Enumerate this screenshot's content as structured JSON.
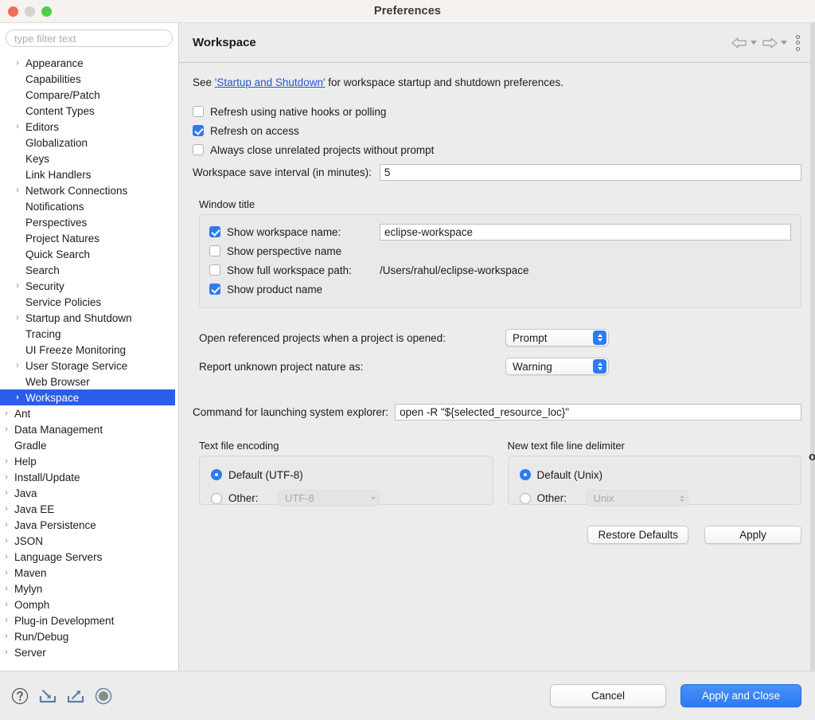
{
  "window": {
    "title": "Preferences",
    "traffic_lights": [
      "close",
      "minimize",
      "zoom"
    ]
  },
  "sidebar": {
    "filter_placeholder": "type filter text",
    "filter_value": "",
    "items": [
      {
        "label": "Appearance",
        "level": 1,
        "expandable": true,
        "selected": false
      },
      {
        "label": "Capabilities",
        "level": 1,
        "expandable": false,
        "selected": false
      },
      {
        "label": "Compare/Patch",
        "level": 1,
        "expandable": false,
        "selected": false
      },
      {
        "label": "Content Types",
        "level": 1,
        "expandable": false,
        "selected": false
      },
      {
        "label": "Editors",
        "level": 1,
        "expandable": true,
        "selected": false
      },
      {
        "label": "Globalization",
        "level": 1,
        "expandable": false,
        "selected": false
      },
      {
        "label": "Keys",
        "level": 1,
        "expandable": false,
        "selected": false
      },
      {
        "label": "Link Handlers",
        "level": 1,
        "expandable": false,
        "selected": false
      },
      {
        "label": "Network Connections",
        "level": 1,
        "expandable": true,
        "selected": false
      },
      {
        "label": "Notifications",
        "level": 1,
        "expandable": false,
        "selected": false
      },
      {
        "label": "Perspectives",
        "level": 1,
        "expandable": false,
        "selected": false
      },
      {
        "label": "Project Natures",
        "level": 1,
        "expandable": false,
        "selected": false
      },
      {
        "label": "Quick Search",
        "level": 1,
        "expandable": false,
        "selected": false
      },
      {
        "label": "Search",
        "level": 1,
        "expandable": false,
        "selected": false
      },
      {
        "label": "Security",
        "level": 1,
        "expandable": true,
        "selected": false
      },
      {
        "label": "Service Policies",
        "level": 1,
        "expandable": false,
        "selected": false
      },
      {
        "label": "Startup and Shutdown",
        "level": 1,
        "expandable": true,
        "selected": false
      },
      {
        "label": "Tracing",
        "level": 1,
        "expandable": false,
        "selected": false
      },
      {
        "label": "UI Freeze Monitoring",
        "level": 1,
        "expandable": false,
        "selected": false
      },
      {
        "label": "User Storage Service",
        "level": 1,
        "expandable": true,
        "selected": false
      },
      {
        "label": "Web Browser",
        "level": 1,
        "expandable": false,
        "selected": false
      },
      {
        "label": "Workspace",
        "level": 1,
        "expandable": true,
        "selected": true
      },
      {
        "label": "Ant",
        "level": 0,
        "expandable": true,
        "selected": false
      },
      {
        "label": "Data Management",
        "level": 0,
        "expandable": true,
        "selected": false
      },
      {
        "label": "Gradle",
        "level": 0,
        "expandable": false,
        "selected": false
      },
      {
        "label": "Help",
        "level": 0,
        "expandable": true,
        "selected": false
      },
      {
        "label": "Install/Update",
        "level": 0,
        "expandable": true,
        "selected": false
      },
      {
        "label": "Java",
        "level": 0,
        "expandable": true,
        "selected": false
      },
      {
        "label": "Java EE",
        "level": 0,
        "expandable": true,
        "selected": false
      },
      {
        "label": "Java Persistence",
        "level": 0,
        "expandable": true,
        "selected": false
      },
      {
        "label": "JSON",
        "level": 0,
        "expandable": true,
        "selected": false
      },
      {
        "label": "Language Servers",
        "level": 0,
        "expandable": true,
        "selected": false
      },
      {
        "label": "Maven",
        "level": 0,
        "expandable": true,
        "selected": false
      },
      {
        "label": "Mylyn",
        "level": 0,
        "expandable": true,
        "selected": false
      },
      {
        "label": "Oomph",
        "level": 0,
        "expandable": true,
        "selected": false
      },
      {
        "label": "Plug-in Development",
        "level": 0,
        "expandable": true,
        "selected": false
      },
      {
        "label": "Run/Debug",
        "level": 0,
        "expandable": true,
        "selected": false
      },
      {
        "label": "Server",
        "level": 0,
        "expandable": true,
        "selected": false
      }
    ]
  },
  "page": {
    "title": "Workspace",
    "toolbar": {
      "back_icon": "back-arrow-icon",
      "forward_icon": "forward-arrow-icon",
      "menu_icon": "vertical-ellipsis-icon"
    },
    "intro": {
      "prefix": "See ",
      "link": "'Startup and Shutdown'",
      "suffix": " for workspace startup and shutdown preferences."
    },
    "checkboxes": [
      {
        "label": "Refresh using native hooks or polling",
        "checked": false
      },
      {
        "label": "Refresh on access",
        "checked": true
      },
      {
        "label": "Always close unrelated projects without prompt",
        "checked": false
      }
    ],
    "save_interval": {
      "label": "Workspace save interval (in minutes):",
      "value": "5"
    },
    "window_title_group": {
      "title": "Window title",
      "rows": [
        {
          "label": "Show workspace name:",
          "checked": true,
          "field_value": "eclipse-workspace",
          "field_type": "input"
        },
        {
          "label": "Show perspective name",
          "checked": false,
          "field_value": "",
          "field_type": "none"
        },
        {
          "label": "Show full workspace path:",
          "checked": false,
          "field_value": "/Users/rahul/eclipse-workspace",
          "field_type": "readonly"
        },
        {
          "label": "Show product name",
          "checked": true,
          "field_value": "",
          "field_type": "none"
        }
      ]
    },
    "combos": [
      {
        "label": "Open referenced projects when a project is opened:",
        "value": "Prompt"
      },
      {
        "label": "Report unknown project nature as:",
        "value": "Warning"
      }
    ],
    "command": {
      "label": "Command for launching system explorer:",
      "value": "open -R \"${selected_resource_loc}\""
    },
    "encoding_group": {
      "title": "Text file encoding",
      "default_label": "Default (UTF-8)",
      "default_selected": true,
      "other_label": "Other:",
      "other_selected": false,
      "other_value": "UTF-8"
    },
    "delimiter_group": {
      "title": "New text file line delimiter",
      "default_label": "Default (Unix)",
      "default_selected": true,
      "other_label": "Other:",
      "other_selected": false,
      "other_value": "Unix"
    },
    "page_buttons": {
      "restore_defaults": "Restore Defaults",
      "apply": "Apply"
    }
  },
  "footer": {
    "icons": [
      {
        "name": "help-icon"
      },
      {
        "name": "import-icon"
      },
      {
        "name": "export-icon"
      },
      {
        "name": "record-icon"
      }
    ],
    "cancel": "Cancel",
    "apply_and_close": "Apply and Close"
  },
  "colors": {
    "selection_blue": "#2c5ce8",
    "accent_blue": "#2b7bf3",
    "link_blue": "#2a55d4",
    "dialog_bg": "#ececec",
    "titlebar_bg": "#f6f2f0"
  }
}
